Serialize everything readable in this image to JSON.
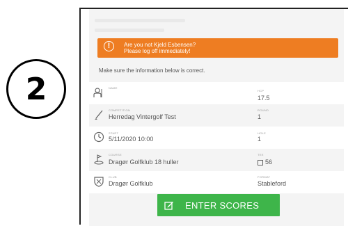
{
  "step": "2",
  "alert": {
    "icon": "exclamation-icon",
    "line1": "Are you not Kjeld Esbensen?",
    "line2": "Please log off immediately!"
  },
  "intro": "Make sure the information below is correct.",
  "fields": {
    "name": {
      "label": "NAME",
      "value": ""
    },
    "hcp": {
      "label": "HCP",
      "value": "17.5"
    },
    "competition": {
      "label": "COMPETITION",
      "value": "Herredag Vintergolf Test"
    },
    "round": {
      "label": "ROUND",
      "value": "1"
    },
    "start": {
      "label": "START",
      "value": "5/11/2020 10:00"
    },
    "hole": {
      "label": "HOLE",
      "value": "1"
    },
    "course": {
      "label": "COURSE",
      "value": "Dragør Golfklub 18 huller"
    },
    "tee": {
      "label": "TEE",
      "value": "56"
    },
    "club": {
      "label": "CLUB",
      "value": "Dragør Golfklub"
    },
    "format": {
      "label": "FORMAT",
      "value": "Stableford"
    }
  },
  "button": {
    "label": "ENTER SCORES",
    "icon": "edit-icon"
  },
  "colors": {
    "alert": "#ee7d22",
    "button": "#3eb54a"
  }
}
